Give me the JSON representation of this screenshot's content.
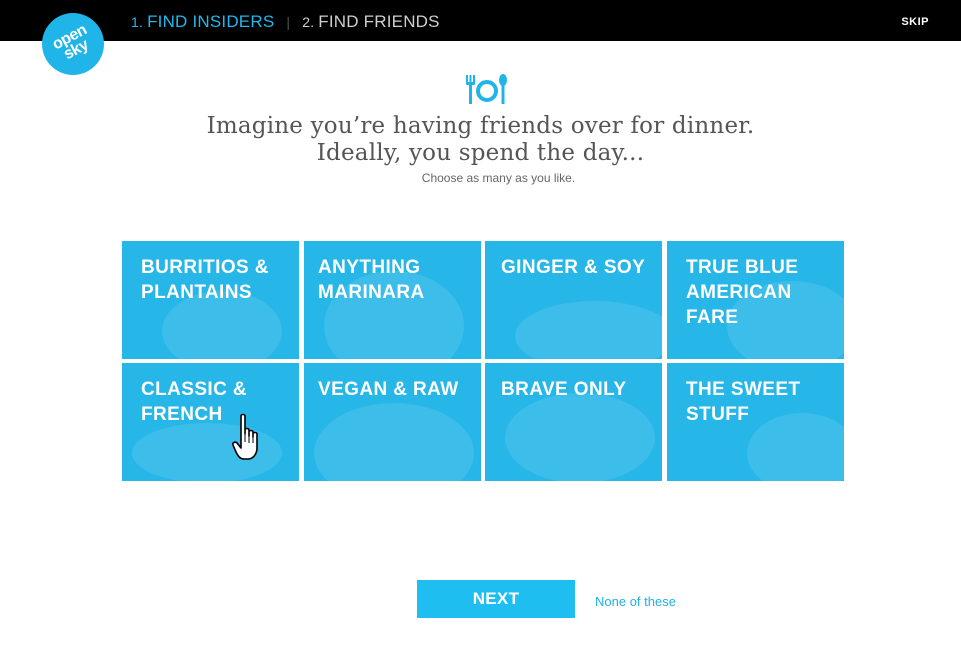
{
  "logo": {
    "line1": "open",
    "line2": "sky"
  },
  "steps": [
    {
      "num": "1.",
      "label": "FIND INSIDERS"
    },
    {
      "num": "2.",
      "label": "FIND FRIENDS"
    }
  ],
  "skip_label": "SKIP",
  "prompt": {
    "line1": "Imagine you’re having friends over for dinner.",
    "line2": "Ideally, you spend the day...",
    "hint": "Choose as many as you like."
  },
  "tiles": [
    {
      "label": "BURRITIOS & PLANTAINS"
    },
    {
      "label": "ANYTHING MARINARA"
    },
    {
      "label": "GINGER & SOY"
    },
    {
      "label": "TRUE BLUE AMERICAN FARE"
    },
    {
      "label": "CLASSIC & FRENCH"
    },
    {
      "label": "VEGAN & RAW"
    },
    {
      "label": "BRAVE ONLY"
    },
    {
      "label": "THE SWEET STUFF"
    }
  ],
  "next_label": "NEXT",
  "none_label": "None of these",
  "colors": {
    "accent": "#1fb5e9",
    "topbar": "#000000",
    "tile": "#27b6e8"
  },
  "icons": {
    "dinner": "fork-plate-spoon-icon",
    "cursor": "hand-pointer-icon"
  }
}
